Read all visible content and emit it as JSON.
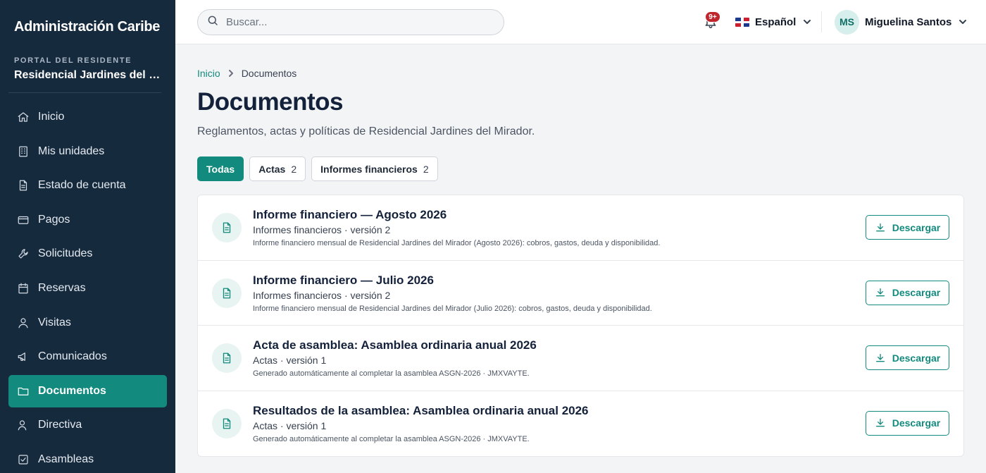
{
  "sidebar": {
    "brand": "Administración Caribe",
    "portal_label": "PORTAL DEL RESIDENTE",
    "portal_name": "Residencial Jardines del Mirador",
    "items": [
      {
        "label": "Inicio",
        "icon": "home-icon"
      },
      {
        "label": "Mis unidades",
        "icon": "building-icon"
      },
      {
        "label": "Estado de cuenta",
        "icon": "document-icon"
      },
      {
        "label": "Pagos",
        "icon": "credit-card-icon"
      },
      {
        "label": "Solicitudes",
        "icon": "wrench-icon"
      },
      {
        "label": "Reservas",
        "icon": "calendar-icon"
      },
      {
        "label": "Visitas",
        "icon": "user-icon"
      },
      {
        "label": "Comunicados",
        "icon": "megaphone-icon"
      },
      {
        "label": "Documentos",
        "icon": "folder-icon",
        "active": true
      },
      {
        "label": "Directiva",
        "icon": "users-icon"
      },
      {
        "label": "Asambleas",
        "icon": "checkbox-icon"
      }
    ]
  },
  "header": {
    "search_placeholder": "Buscar...",
    "notifications_badge": "9+",
    "language": "Español",
    "user_initials": "MS",
    "user_name": "Miguelina Santos"
  },
  "breadcrumb": {
    "home": "Inicio",
    "current": "Documentos"
  },
  "page": {
    "title": "Documentos",
    "subtitle": "Reglamentos, actas y políticas de Residencial Jardines del Mirador."
  },
  "filters": [
    {
      "label": "Todas",
      "count": "",
      "active": true
    },
    {
      "label": "Actas",
      "count": "2",
      "active": false
    },
    {
      "label": "Informes financieros",
      "count": "2",
      "active": false
    }
  ],
  "documents": [
    {
      "title": "Informe financiero — Agosto 2026",
      "meta": "Informes financieros · versión 2",
      "description": "Informe financiero mensual de Residencial Jardines del Mirador (Agosto 2026): cobros, gastos, deuda y disponibilidad.",
      "action": "Descargar"
    },
    {
      "title": "Informe financiero — Julio 2026",
      "meta": "Informes financieros · versión 2",
      "description": "Informe financiero mensual de Residencial Jardines del Mirador (Julio 2026): cobros, gastos, deuda y disponibilidad.",
      "action": "Descargar"
    },
    {
      "title": "Acta de asamblea: Asamblea ordinaria anual 2026",
      "meta": "Actas · versión 1",
      "description": "Generado automáticamente al completar la asamblea ASGN-2026 · JMXVAYTE.",
      "action": "Descargar"
    },
    {
      "title": "Resultados de la asamblea: Asamblea ordinaria anual 2026",
      "meta": "Actas · versión 1",
      "description": "Generado automáticamente al completar la asamblea ASGN-2026 · JMXVAYTE.",
      "action": "Descargar"
    }
  ],
  "colors": {
    "sidebar_bg": "#162a3e",
    "accent": "#128a7d",
    "badge": "#c0262d"
  }
}
